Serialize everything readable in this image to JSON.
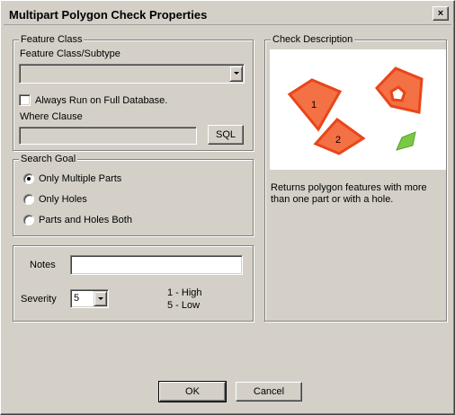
{
  "window": {
    "title": "Multipart Polygon Check Properties",
    "close_label": "×"
  },
  "feature_class": {
    "group_label": "Feature Class",
    "subtype_label": "Feature Class/Subtype",
    "subtype_value": "",
    "always_run_label": "Always Run on Full Database.",
    "always_run_checked": false,
    "where_clause_label": "Where Clause",
    "where_clause_value": "",
    "sql_button": "SQL"
  },
  "search_goal": {
    "group_label": "Search Goal",
    "options": [
      {
        "label": "Only Multiple Parts",
        "checked": true
      },
      {
        "label": "Only Holes",
        "checked": false
      },
      {
        "label": "Parts and Holes Both",
        "checked": false
      }
    ]
  },
  "notes_section": {
    "notes_label": "Notes",
    "notes_value": "",
    "severity_label": "Severity",
    "severity_value": "5",
    "severity_high": "1 - High",
    "severity_low": "5 - Low"
  },
  "check_description": {
    "group_label": "Check Description",
    "illustration": {
      "polygon_1_label": "1",
      "polygon_2_label": "2",
      "polygon_fill": "#f47045",
      "polygon_stroke": "#e8461a",
      "green_fill": "#7ac943",
      "green_stroke": "#5aa02c"
    },
    "text": "Returns polygon features with more than one part or with a hole."
  },
  "buttons": {
    "ok": "OK",
    "cancel": "Cancel"
  }
}
